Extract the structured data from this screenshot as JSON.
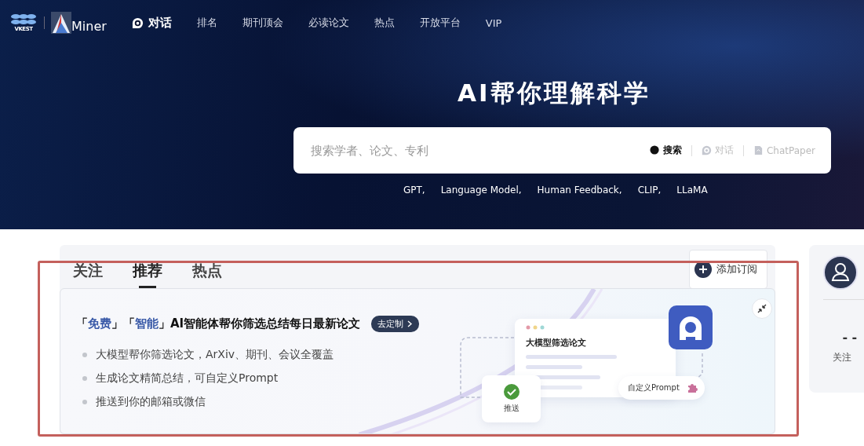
{
  "header": {
    "brand_primary": "VKEST",
    "brand_secondary": "Miner",
    "nav": [
      {
        "label": "对话",
        "selected": true,
        "kind": "chat"
      },
      {
        "label": "排名",
        "selected": false
      },
      {
        "label": "期刊顶会",
        "selected": false
      },
      {
        "label": "必读论文",
        "selected": false
      },
      {
        "label": "热点",
        "selected": false
      },
      {
        "label": "开放平台",
        "selected": false
      },
      {
        "label": "VIP",
        "selected": false
      }
    ]
  },
  "hero": {
    "title": "AI帮你理解科学",
    "search": {
      "placeholder": "搜索学者、论文、专利",
      "modes": [
        {
          "label": "搜索",
          "selected": true,
          "kind": "search"
        },
        {
          "label": "对话",
          "selected": false,
          "kind": "chat"
        },
        {
          "label": "ChatPaper",
          "selected": false,
          "kind": "paper"
        }
      ]
    },
    "keywords": [
      "GPT,",
      "Language Model,",
      "Human Feedback,",
      "CLIP,",
      "LLaMA"
    ]
  },
  "feed": {
    "tabs": [
      {
        "label": "关注",
        "selected": false
      },
      {
        "label": "推荐",
        "selected": true
      },
      {
        "label": "热点",
        "selected": false
      }
    ],
    "subscribe_button": "添加订阅",
    "banner": {
      "headline": "「**免费**」「**智能**」AI智能体帮你筛选总结每日最新论文",
      "cta": "去定制",
      "bullets": [
        "大模型帮你筛选论文，ArXiv、期刊、会议全覆盖",
        "生成论文精简总结，可自定义Prompt",
        "推送到你的邮箱或微信"
      ],
      "illustration": {
        "window_title": "大模型筛选论文",
        "push_label": "推送",
        "prompt_label": "自定义Prompt"
      }
    }
  },
  "side_panel": {
    "count": "- -",
    "label": "关注"
  }
}
